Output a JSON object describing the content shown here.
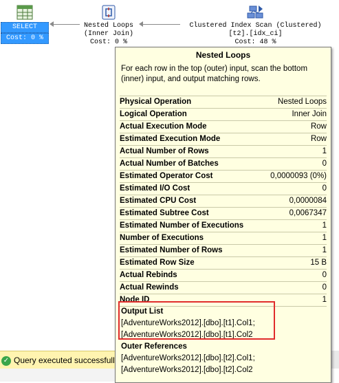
{
  "plan": {
    "select_node": {
      "title": "SELECT",
      "cost": "Cost: 0 %",
      "icon": "select-icon"
    },
    "loops_node": {
      "title": "Nested Loops",
      "subtitle": "(Inner Join)",
      "cost": "Cost: 0 %",
      "icon": "nested-loops-icon"
    },
    "scan_node": {
      "title": "Clustered Index Scan (Clustered)",
      "subtitle": "[t2].[idx_ci]",
      "cost": "Cost: 48 %",
      "icon": "clustered-index-scan-icon"
    }
  },
  "tooltip": {
    "title": "Nested Loops",
    "description": "For each row in the top (outer) input, scan the bottom (inner) input, and output matching rows.",
    "properties": [
      {
        "name": "Physical Operation",
        "value": "Nested Loops"
      },
      {
        "name": "Logical Operation",
        "value": "Inner Join"
      },
      {
        "name": "Actual Execution Mode",
        "value": "Row"
      },
      {
        "name": "Estimated Execution Mode",
        "value": "Row"
      },
      {
        "name": "Actual Number of Rows",
        "value": "1"
      },
      {
        "name": "Actual Number of Batches",
        "value": "0"
      },
      {
        "name": "Estimated Operator Cost",
        "value": "0,0000093 (0%)"
      },
      {
        "name": "Estimated I/O Cost",
        "value": "0"
      },
      {
        "name": "Estimated CPU Cost",
        "value": "0,0000084"
      },
      {
        "name": "Estimated Subtree Cost",
        "value": "0,0067347"
      },
      {
        "name": "Estimated Number of Executions",
        "value": "1"
      },
      {
        "name": "Number of Executions",
        "value": "1"
      },
      {
        "name": "Estimated Number of Rows",
        "value": "1"
      },
      {
        "name": "Estimated Row Size",
        "value": "15 B"
      },
      {
        "name": "Actual Rebinds",
        "value": "0"
      },
      {
        "name": "Actual Rewinds",
        "value": "0"
      },
      {
        "name": "Node ID",
        "value": "1"
      }
    ],
    "output_list": {
      "title": "Output List",
      "lines": [
        "[AdventureWorks2012].[dbo].[t1].Col1;",
        "[AdventureWorks2012].[dbo].[t1].Col2"
      ]
    },
    "outer_references": {
      "title": "Outer References",
      "lines": [
        "[AdventureWorks2012].[dbo].[t2].Col1;",
        "[AdventureWorks2012].[dbo].[t2].Col2"
      ]
    }
  },
  "status": {
    "text": "Query executed successfully.",
    "icon": "success-check-icon",
    "color": "#fff4b0"
  },
  "colors": {
    "tooltip_bg": "#ffffe1",
    "highlight": "#e02b2b",
    "select_bg": "#3399ff"
  }
}
